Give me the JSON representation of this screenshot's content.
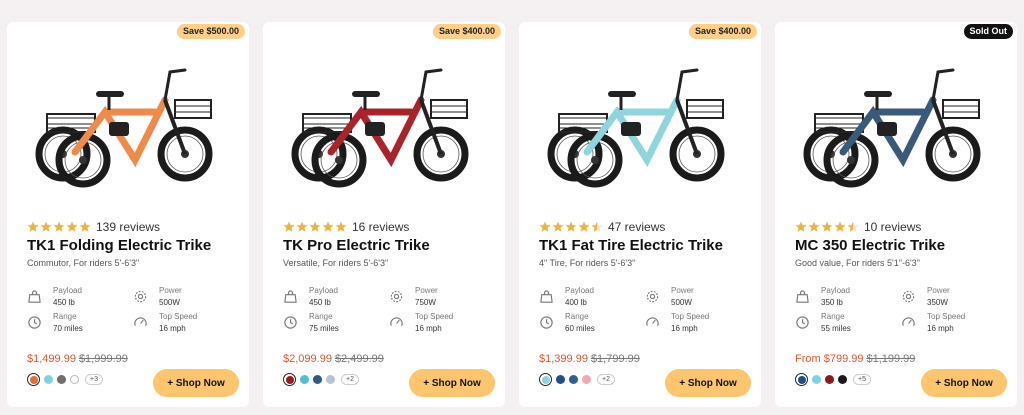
{
  "labels": {
    "payload": "Payload",
    "power": "Power",
    "range": "Range",
    "top_speed": "Top Speed",
    "shop": "+ Shop Now"
  },
  "colors": {
    "star": "#f0b23c",
    "sale_price": "#e0552d",
    "button": "#fcc56e",
    "badge": "#fcd08a"
  },
  "products": [
    {
      "badge": "Save $500.00",
      "rating": 5,
      "reviews": "139 reviews",
      "title": "TK1 Folding Electric Trike",
      "subtitle": "Commutor, For riders 5'-6'3\"",
      "payload": "450 lb",
      "power": "500W",
      "range": "70 miles",
      "top_speed": "16 mph",
      "price": "$1,499.99",
      "was_price": "$1,999.99",
      "frame_color": "#f08a4b",
      "swatches": [
        "#e86a32",
        "#7fd3e0",
        "#6f6f6f",
        "#ffffff"
      ],
      "more": "+3"
    },
    {
      "badge": "Save $400.00",
      "rating": 5,
      "reviews": "16 reviews",
      "title": "TK Pro Electric Trike",
      "subtitle": "Versatile, For riders 5'-6'3\"",
      "payload": "450 lb",
      "power": "750W",
      "range": "75 miles",
      "top_speed": "16 mph",
      "price": "$2,099.99",
      "was_price": "$2,499.99",
      "frame_color": "#a8242a",
      "swatches": [
        "#9b1c22",
        "#4fbfd1",
        "#2f5a8c",
        "#b7c3d0"
      ],
      "more": "+2"
    },
    {
      "badge": "Save $400.00",
      "rating": 4.5,
      "reviews": "47 reviews",
      "title": "TK1 Fat Tire Electric Trike",
      "subtitle": "4\" Tire, For riders 5'-6'3\"",
      "payload": "400 lb",
      "power": "500W",
      "range": "60 miles",
      "top_speed": "16 mph",
      "price": "$1,399.99",
      "was_price": "$1,799.99",
      "frame_color": "#8fd6dc",
      "swatches": [
        "#8fd6dc",
        "#1e4f86",
        "#2d5f96",
        "#f0aab0"
      ],
      "more": "+2"
    },
    {
      "badge": "Sold Out",
      "rating": 4.5,
      "reviews": "10 reviews",
      "title": "MC 350 Electric Trike",
      "subtitle": "Good value, For riders 5'1\"-6'3\"",
      "payload": "350 lb",
      "power": "350W",
      "range": "55 miles",
      "top_speed": "16 mph",
      "price": "From $799.99",
      "was_price": "$1,199.99",
      "frame_color": "#3a5a7a",
      "swatches": [
        "#1e4f86",
        "#7fd3e0",
        "#8b1a1a",
        "#1a1a1a"
      ],
      "more": "+5"
    }
  ]
}
